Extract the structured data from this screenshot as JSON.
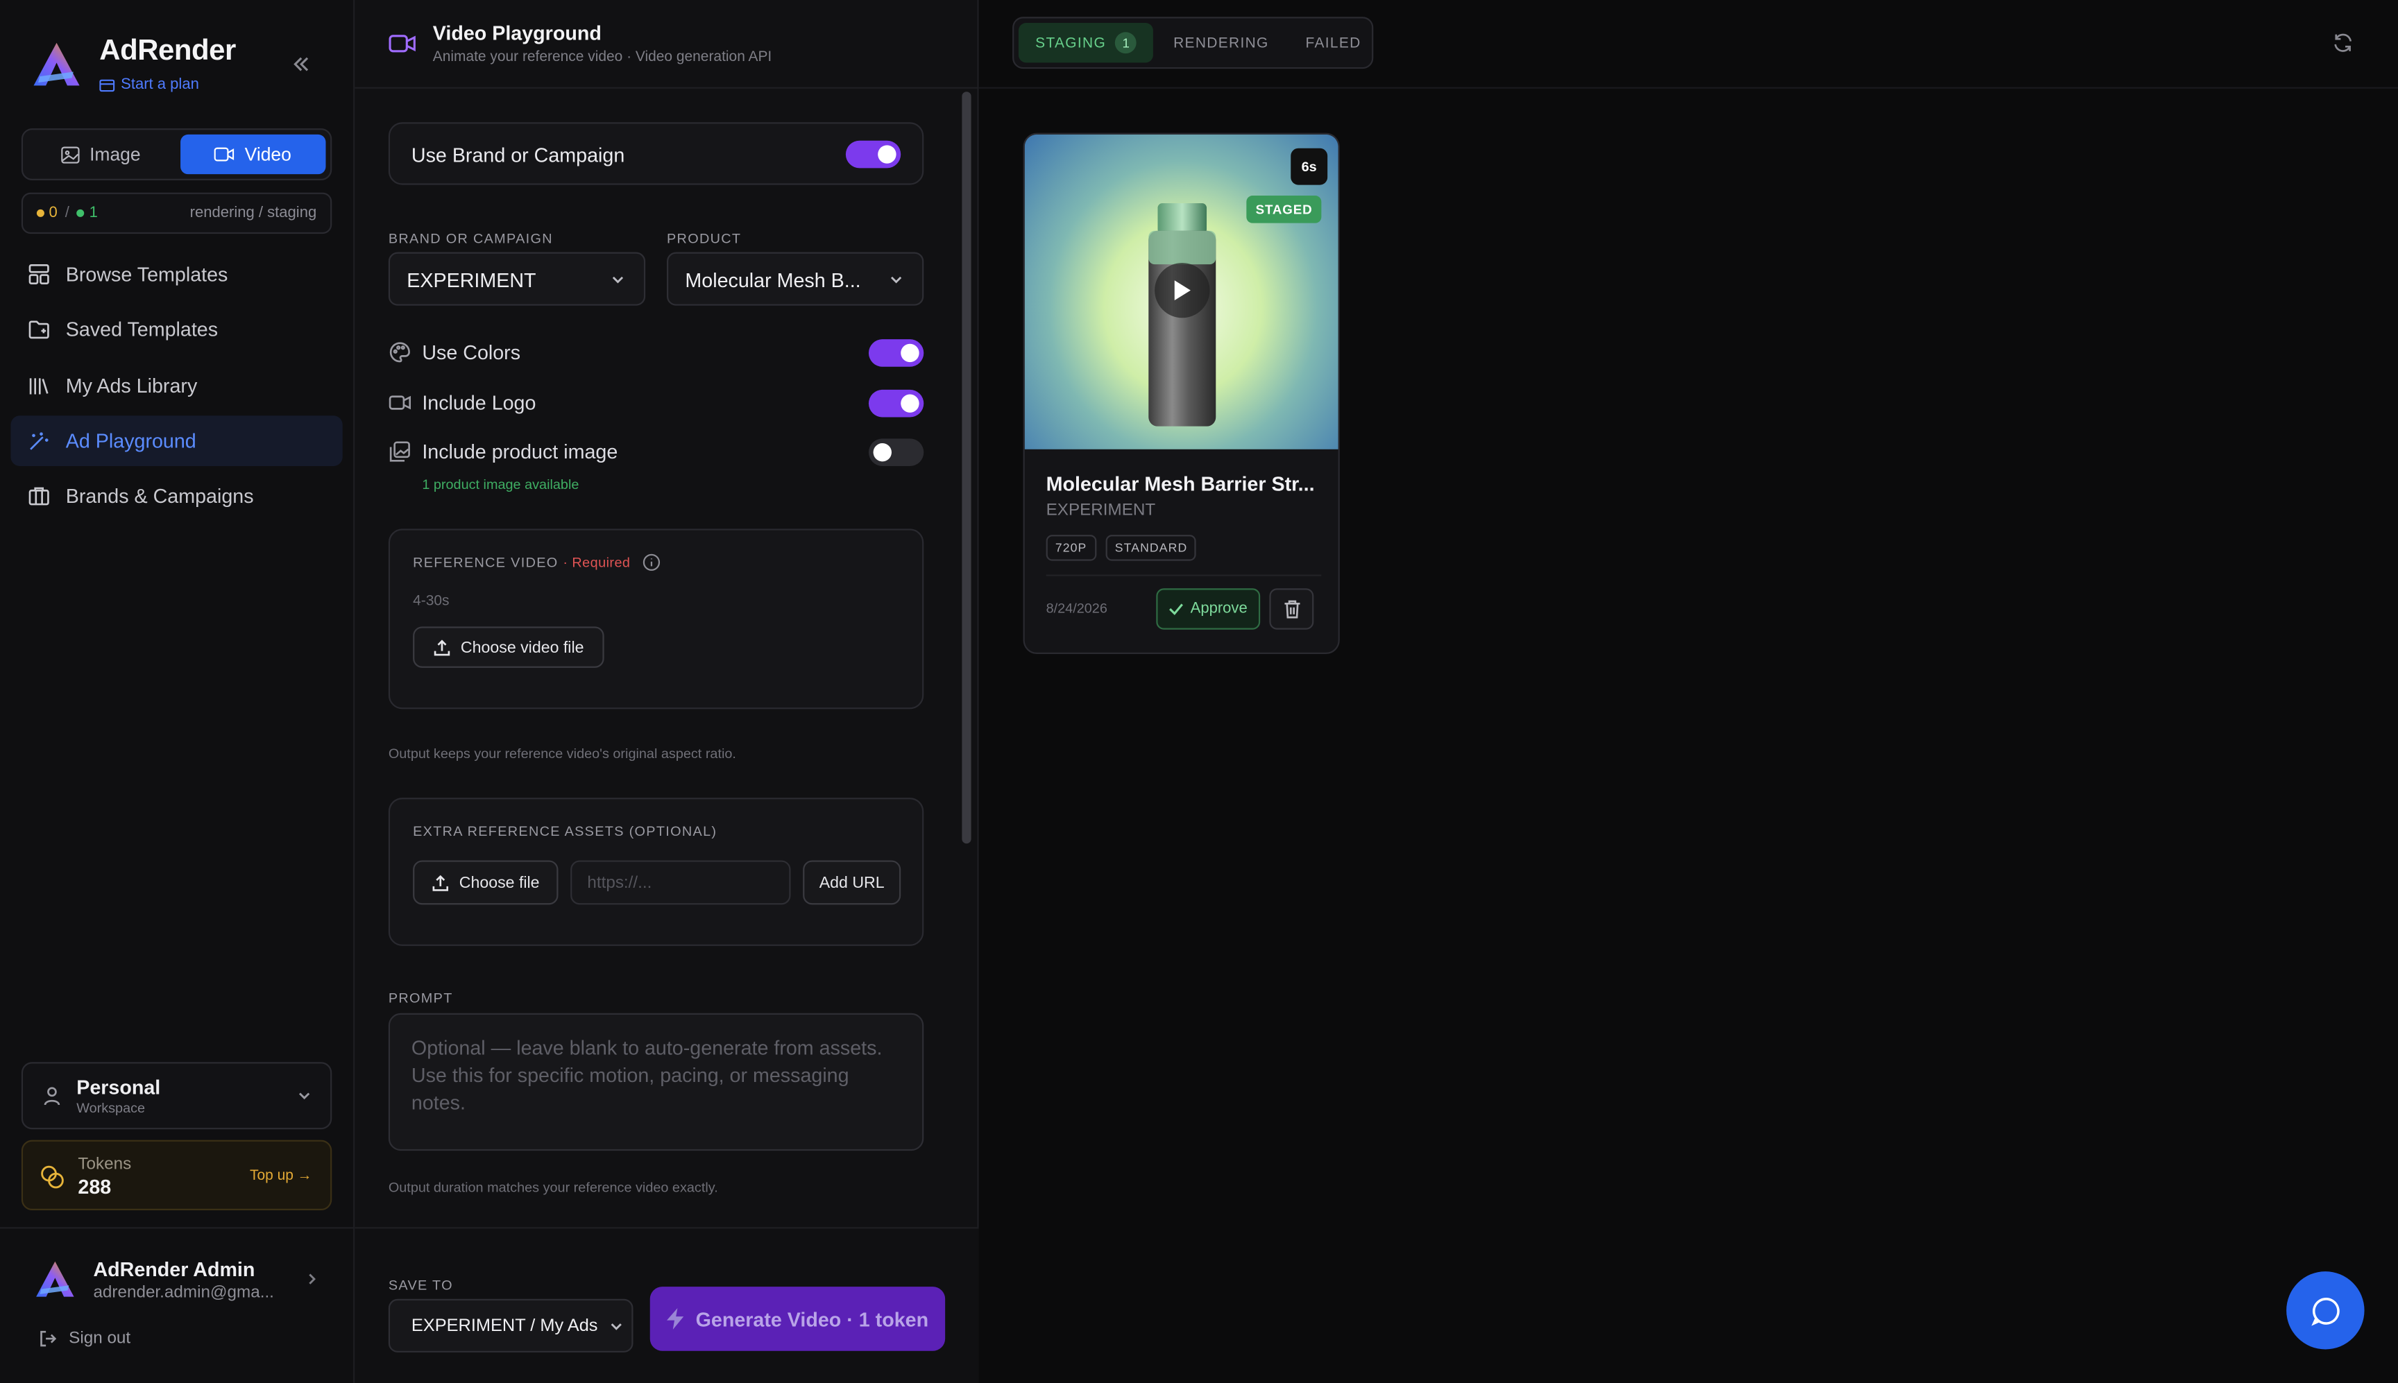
{
  "sidebar": {
    "app_name": "AdRender",
    "start_plan": "Start a plan",
    "mode_toggle": {
      "image": "Image",
      "video": "Video",
      "active": "video"
    },
    "status": {
      "rendering_count": "0",
      "separator": "/",
      "staging_count": "1",
      "label": "rendering / staging",
      "rendering_color": "#e7b43a",
      "staging_color": "#3fbf6a"
    },
    "nav": [
      {
        "label": "Browse Templates",
        "icon": "layout-icon"
      },
      {
        "label": "Saved Templates",
        "icon": "folder-icon"
      },
      {
        "label": "My Ads Library",
        "icon": "library-icon"
      },
      {
        "label": "Ad Playground",
        "icon": "wand-icon",
        "active": true
      },
      {
        "label": "Brands & Campaigns",
        "icon": "briefcase-icon"
      }
    ],
    "workspace": {
      "name": "Personal",
      "sub": "Workspace"
    },
    "tokens": {
      "label": "Tokens",
      "value": "288",
      "topup": "Top up →"
    },
    "user": {
      "name": "AdRender Admin",
      "email": "adrender.admin@gma..."
    },
    "signout": "Sign out"
  },
  "playground": {
    "title": "Video Playground",
    "subtitle": "Animate your reference video · Video generation API",
    "use_brand": {
      "label": "Use Brand or Campaign",
      "on": true
    },
    "brand_label": "BRAND OR CAMPAIGN",
    "brand_value": "EXPERIMENT",
    "product_label": "PRODUCT",
    "product_value": "Molecular Mesh B...",
    "use_colors": {
      "label": "Use Colors",
      "on": true
    },
    "include_logo": {
      "label": "Include Logo",
      "on": true
    },
    "include_product": {
      "label": "Include product image",
      "on": false
    },
    "product_available": "1 product image available",
    "reference": {
      "title": "REFERENCE VIDEO",
      "required": "· Required",
      "range": "4-30s",
      "button": "Choose video file"
    },
    "aspect_note": "Output keeps your reference video's original aspect ratio.",
    "extra": {
      "title": "EXTRA REFERENCE ASSETS (OPTIONAL)",
      "choose": "Choose file",
      "url_placeholder": "https://...",
      "add_url": "Add URL"
    },
    "prompt_label": "PROMPT",
    "prompt_placeholder": "Optional — leave blank to auto-generate from assets. Use this for specific motion, pacing, or messaging notes.",
    "duration_note": "Output duration matches your reference video exactly.",
    "save_to_label": "SAVE TO",
    "save_to_value": "EXPERIMENT / My Ads",
    "generate": "Generate Video · 1 token"
  },
  "queue": {
    "tabs": [
      {
        "label": "STAGING",
        "count": "1",
        "active": true
      },
      {
        "label": "RENDERING"
      },
      {
        "label": "FAILED"
      }
    ],
    "cards": [
      {
        "title": "Molecular Mesh Barrier Str...",
        "brand": "EXPERIMENT",
        "duration": "6s",
        "status": "STAGED",
        "chips": [
          "720P",
          "STANDARD"
        ],
        "date": "8/24/2026",
        "approve": "Approve"
      }
    ]
  },
  "colors": {
    "accent": "#7c3aed",
    "primary": "#2563eb",
    "success": "#3fae63"
  }
}
